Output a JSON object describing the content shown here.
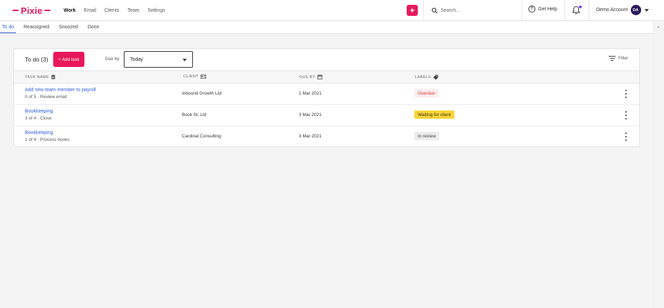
{
  "brand": {
    "name": "Pixie",
    "color": "#e8185c"
  },
  "nav": {
    "items": [
      {
        "label": "Work",
        "active": true
      },
      {
        "label": "Email",
        "active": false
      },
      {
        "label": "Clients",
        "active": false
      },
      {
        "label": "Team",
        "active": false
      },
      {
        "label": "Settings",
        "active": false
      }
    ]
  },
  "header": {
    "add_icon": "plus-icon",
    "search_placeholder": "Search...",
    "help_label": "Get Help",
    "account_label": "Demo Account",
    "avatar_initials": "DA"
  },
  "subtabs": [
    {
      "label": "To do",
      "active": true
    },
    {
      "label": "Reassigned",
      "active": false
    },
    {
      "label": "Snoozed",
      "active": false
    },
    {
      "label": "Done",
      "active": false
    }
  ],
  "card": {
    "title": "To do (3)",
    "add_label": "+ Add task",
    "dueby_label": "Due by",
    "dueby_value": "Today",
    "filter_label": "Filter"
  },
  "table": {
    "columns": [
      "TASK NAME",
      "CLIENT",
      "DUE BY",
      "LABELS"
    ],
    "rows": [
      {
        "task": "Add new team member to payroll",
        "sub": "0 of 5 · Review email",
        "client": "Inbound Growth Ltd",
        "due": "1 Mar 2021",
        "label": "Overdue",
        "label_bg": "#fdecec",
        "label_fg": "#d8343f"
      },
      {
        "task": "Bookkeeping",
        "sub": "3 of 4 · Close",
        "client": "Book St. Ltd",
        "due": "3 Mar 2021",
        "label": "Waiting for client",
        "label_bg": "#f9d53b",
        "label_fg": "#3a2f00"
      },
      {
        "task": "Bookkeeping",
        "sub": "1 of 4 · Process books",
        "client": "Cardinal Consulting",
        "due": "3 Mar 2021",
        "label": "In review",
        "label_bg": "#ebebed",
        "label_fg": "#444444"
      }
    ]
  }
}
